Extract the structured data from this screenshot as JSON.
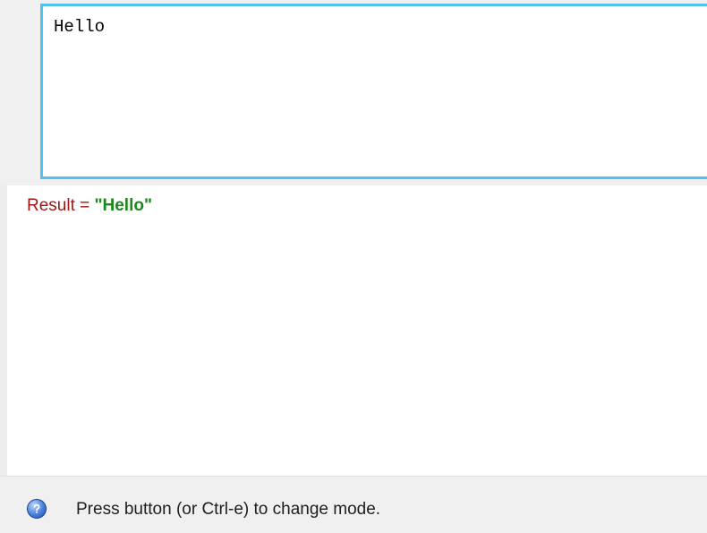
{
  "editor": {
    "value": "Hello"
  },
  "result": {
    "label": "Result = ",
    "value": "\"Hello\""
  },
  "status_bar": {
    "icon": "help-question-icon",
    "message": "Press button (or Ctrl-e) to change mode."
  },
  "colors": {
    "editor_border": "#4fc3ea",
    "result_label": "#a31515",
    "result_value": "#1a8a1a",
    "background": "#f0f0f0"
  }
}
